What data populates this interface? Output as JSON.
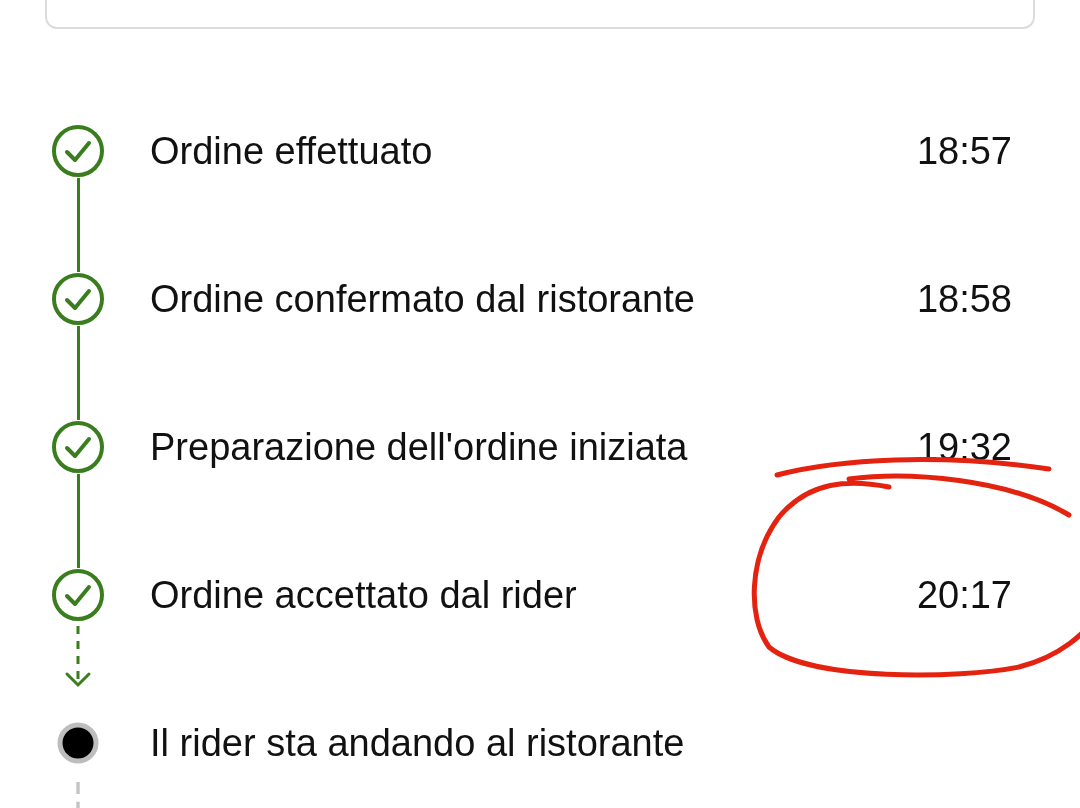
{
  "steps": [
    {
      "label": "Ordine effettuato",
      "time": "18:57",
      "kind": "done",
      "circled": false
    },
    {
      "label": "Ordine confermato dal ristorante",
      "time": "18:58",
      "kind": "done",
      "circled": false
    },
    {
      "label": "Preparazione dell'ordine iniziata",
      "time": "19:32",
      "kind": "done",
      "circled": false
    },
    {
      "label": "Ordine accettato dal rider",
      "time": "20:17",
      "kind": "done",
      "circled": true
    },
    {
      "label": "Il rider sta andando al ristorante",
      "kind": "current",
      "circled": false
    }
  ]
}
